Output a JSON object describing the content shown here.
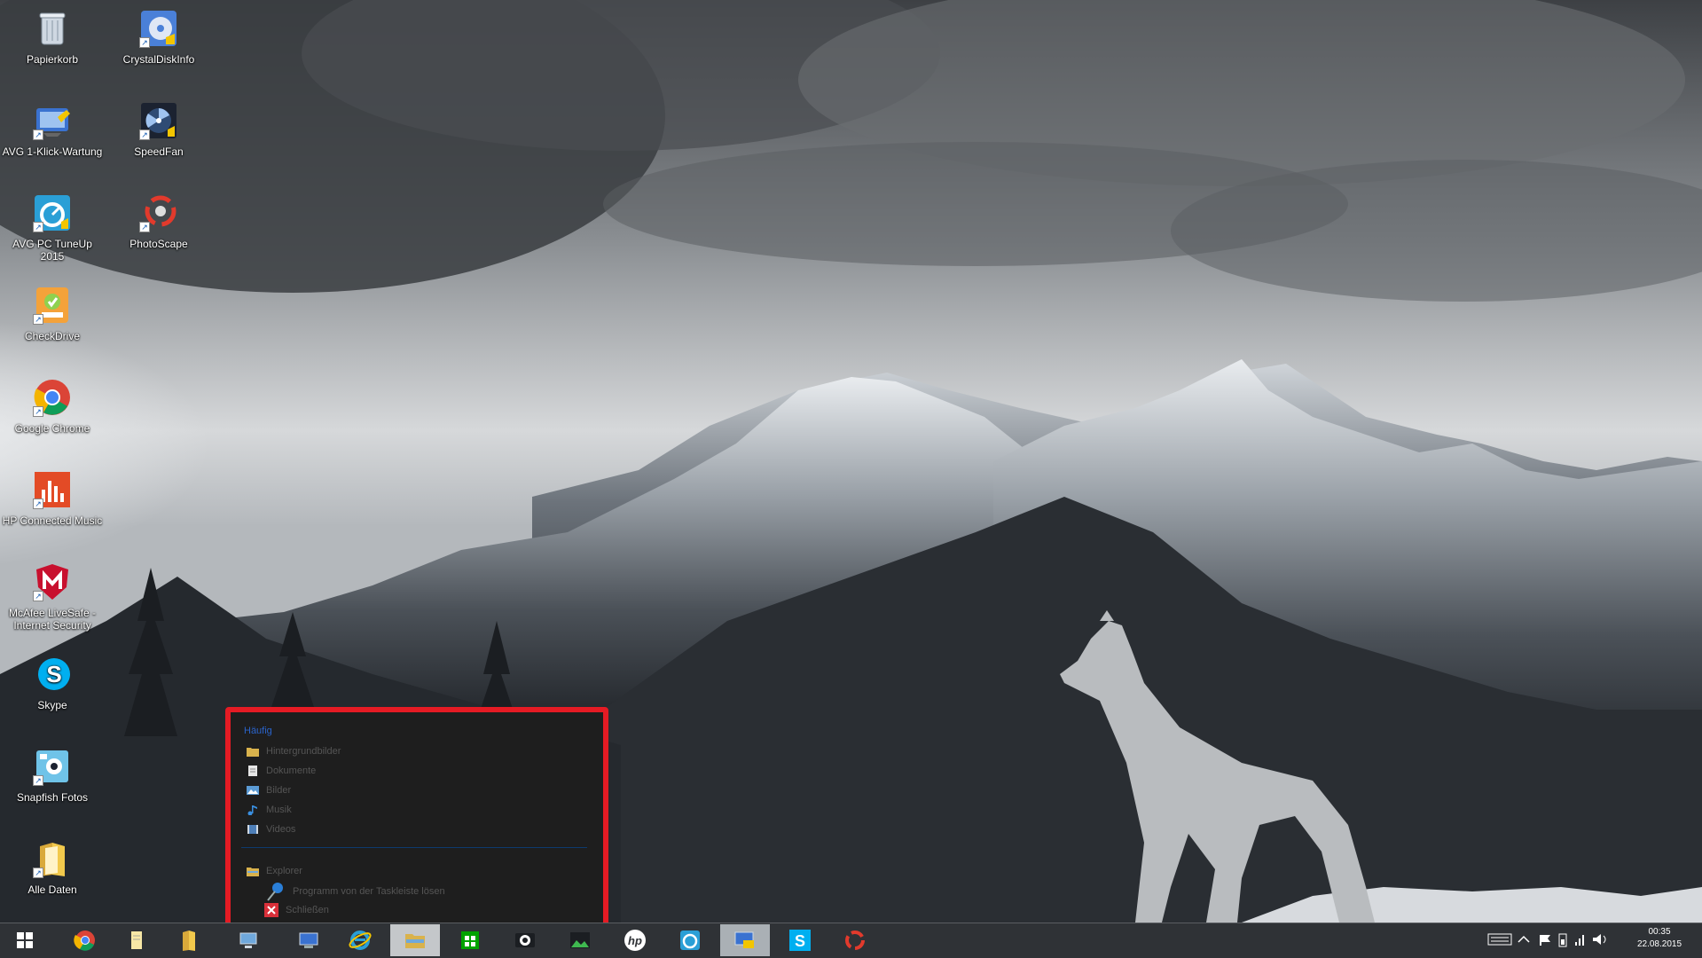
{
  "desktop_icons": [
    {
      "label": "Papierkorb",
      "icon": "recycle-bin-icon"
    },
    {
      "label": "CrystalDiskInfo",
      "icon": "crystaldiskinfo-icon"
    },
    {
      "label": "AVG 1-Klick-Wartung",
      "icon": "avg-maintenance-icon"
    },
    {
      "label": "SpeedFan",
      "icon": "speedfan-icon"
    },
    {
      "label": "AVG PC TuneUp 2015",
      "icon": "avg-tuneup-icon"
    },
    {
      "label": "PhotoScape",
      "icon": "photoscape-icon"
    },
    {
      "label": "CheckDrive",
      "icon": "checkdrive-icon"
    },
    {
      "label": "Google Chrome",
      "icon": "chrome-icon"
    },
    {
      "label": "HP Connected Music",
      "icon": "hp-music-icon"
    },
    {
      "label": "McAfee LiveSafe - Internet Security",
      "icon": "mcafee-icon"
    },
    {
      "label": "Skype",
      "icon": "skype-icon"
    },
    {
      "label": "Snapfish Fotos",
      "icon": "snapfish-icon"
    },
    {
      "label": "Alle Daten",
      "icon": "folder-icon"
    }
  ],
  "jumplist": {
    "header": "Häufig",
    "items": [
      {
        "label": "Hintergrundbilder",
        "icon": "folder-icon"
      },
      {
        "label": "Dokumente",
        "icon": "documents-icon"
      },
      {
        "label": "Bilder",
        "icon": "pictures-icon"
      },
      {
        "label": "Musik",
        "icon": "music-icon"
      },
      {
        "label": "Videos",
        "icon": "videos-icon"
      }
    ],
    "tasks": [
      {
        "label": "Explorer",
        "icon": "explorer-icon"
      },
      {
        "label": "Programm von der Taskleiste lösen",
        "icon": "unpin-icon"
      },
      {
        "label": "Schließen",
        "icon": "close-icon"
      }
    ]
  },
  "taskbar": {
    "buttons": [
      "start-icon",
      "chrome-icon",
      "notepad-icon",
      "folder-icon",
      "network-icon",
      "pc-icon",
      "ie-icon",
      "explorer-icon",
      "store-icon",
      "camera-icon",
      "photos-icon",
      "hp-icon",
      "avg-icon",
      "remote-icon",
      "skype-icon",
      "app-icon"
    ],
    "clock_time": "00:35",
    "clock_date": "22.08.2015"
  },
  "colors": {
    "highlight_frame": "#e51b24",
    "jumplist_bg": "#1e1e1e",
    "taskbar_bg": "#2f3236",
    "jumplist_header": "#2a63c9"
  }
}
